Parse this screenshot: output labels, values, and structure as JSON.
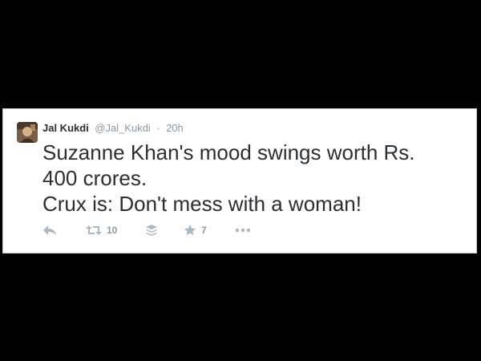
{
  "tweet": {
    "display_name": "Jal Kukdi",
    "handle": "@Jal_Kukdi",
    "separator": "·",
    "timestamp": "20h",
    "text_lines": [
      "Suzanne Khan's mood swings worth Rs.",
      "400 crores.",
      "Crux is: Don't mess with a woman!"
    ]
  },
  "actions": {
    "reply": {
      "icon": "reply-icon"
    },
    "retweet": {
      "icon": "retweet-icon",
      "count": "10"
    },
    "buffer": {
      "icon": "buffer-layers-icon"
    },
    "favorite": {
      "icon": "star-icon",
      "count": "7"
    },
    "more": {
      "icon": "more-dots-icon"
    }
  },
  "colors": {
    "background": "#000000",
    "card": "#ffffff",
    "text": "#292f33",
    "muted": "#8899a6",
    "icon": "#aab8c2"
  }
}
